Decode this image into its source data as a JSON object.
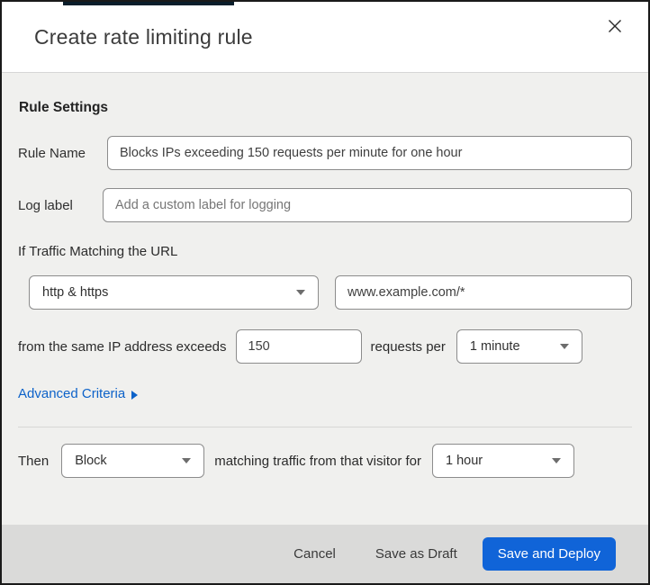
{
  "modal": {
    "title": "Create rate limiting rule"
  },
  "rule_settings": {
    "heading": "Rule Settings",
    "rule_name": {
      "label": "Rule Name",
      "value": "Blocks IPs exceeding 150 requests per minute for one hour"
    },
    "log_label": {
      "label": "Log label",
      "placeholder": "Add a custom label for logging"
    },
    "traffic_match": {
      "intro": "If Traffic Matching the URL",
      "scheme_selected": "http & https",
      "url_value": "www.example.com/*"
    },
    "threshold": {
      "prefix": "from the same IP address exceeds",
      "requests_value": "150",
      "middle": "requests per",
      "period_selected": "1 minute"
    },
    "advanced_criteria_label": "Advanced Criteria"
  },
  "then_section": {
    "label": "Then",
    "action_selected": "Block",
    "middle": "matching traffic from that visitor for",
    "duration_selected": "1 hour"
  },
  "footer": {
    "cancel_label": "Cancel",
    "save_draft_label": "Save as Draft",
    "save_deploy_label": "Save and Deploy"
  },
  "colors": {
    "primary_button": "#1064d8",
    "link_blue": "#0d62c9",
    "body_background": "#f0f0ee",
    "footer_background": "#dadad9"
  }
}
